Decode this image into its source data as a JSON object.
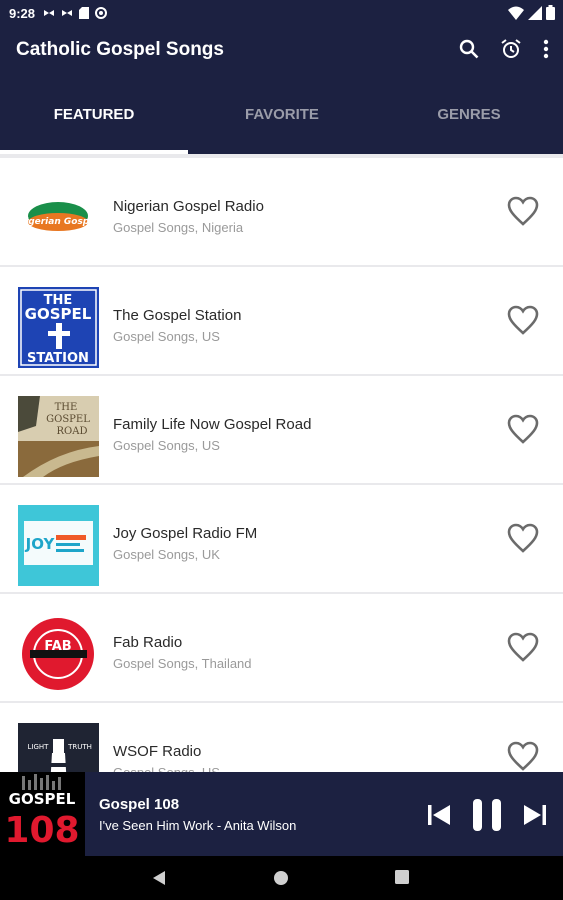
{
  "status": {
    "time": "9:28"
  },
  "app": {
    "title": "Catholic Gospel Songs"
  },
  "tabs": [
    {
      "label": "FEATURED",
      "active": true
    },
    {
      "label": "FAVORITE",
      "active": false
    },
    {
      "label": "GENRES",
      "active": false
    }
  ],
  "stations": [
    {
      "name": "Nigerian Gospel Radio",
      "subtitle": "Gospel Songs, Nigeria"
    },
    {
      "name": "The Gospel Station",
      "subtitle": "Gospel Songs, US"
    },
    {
      "name": "Family Life Now Gospel Road",
      "subtitle": "Gospel Songs, US"
    },
    {
      "name": "Joy Gospel Radio FM",
      "subtitle": "Gospel Songs, UK"
    },
    {
      "name": "Fab Radio",
      "subtitle": "Gospel Songs, Thailand"
    },
    {
      "name": "WSOF Radio",
      "subtitle": "Gospel Songs, US"
    }
  ],
  "logos": {
    "nigerian": "Nigerian Gospel",
    "gospel_station": [
      "THE",
      "GOSPEL",
      "STATION"
    ],
    "family_life": [
      "THE",
      "GOSPEL",
      "ROAD"
    ],
    "joy": "JOY",
    "fab": "FAB",
    "wsof": [
      "LIGHT",
      "TRUTH"
    ],
    "gospel108": [
      "GOSPEL",
      "108"
    ]
  },
  "player": {
    "station": "Gospel 108",
    "track": "I've Seen Him Work - Anita Wilson"
  },
  "colors": {
    "primary": "#1c2141",
    "tab_inactive": "#9a9ca9",
    "heart": "#6b6b6b",
    "accent_red": "#e0192e"
  }
}
